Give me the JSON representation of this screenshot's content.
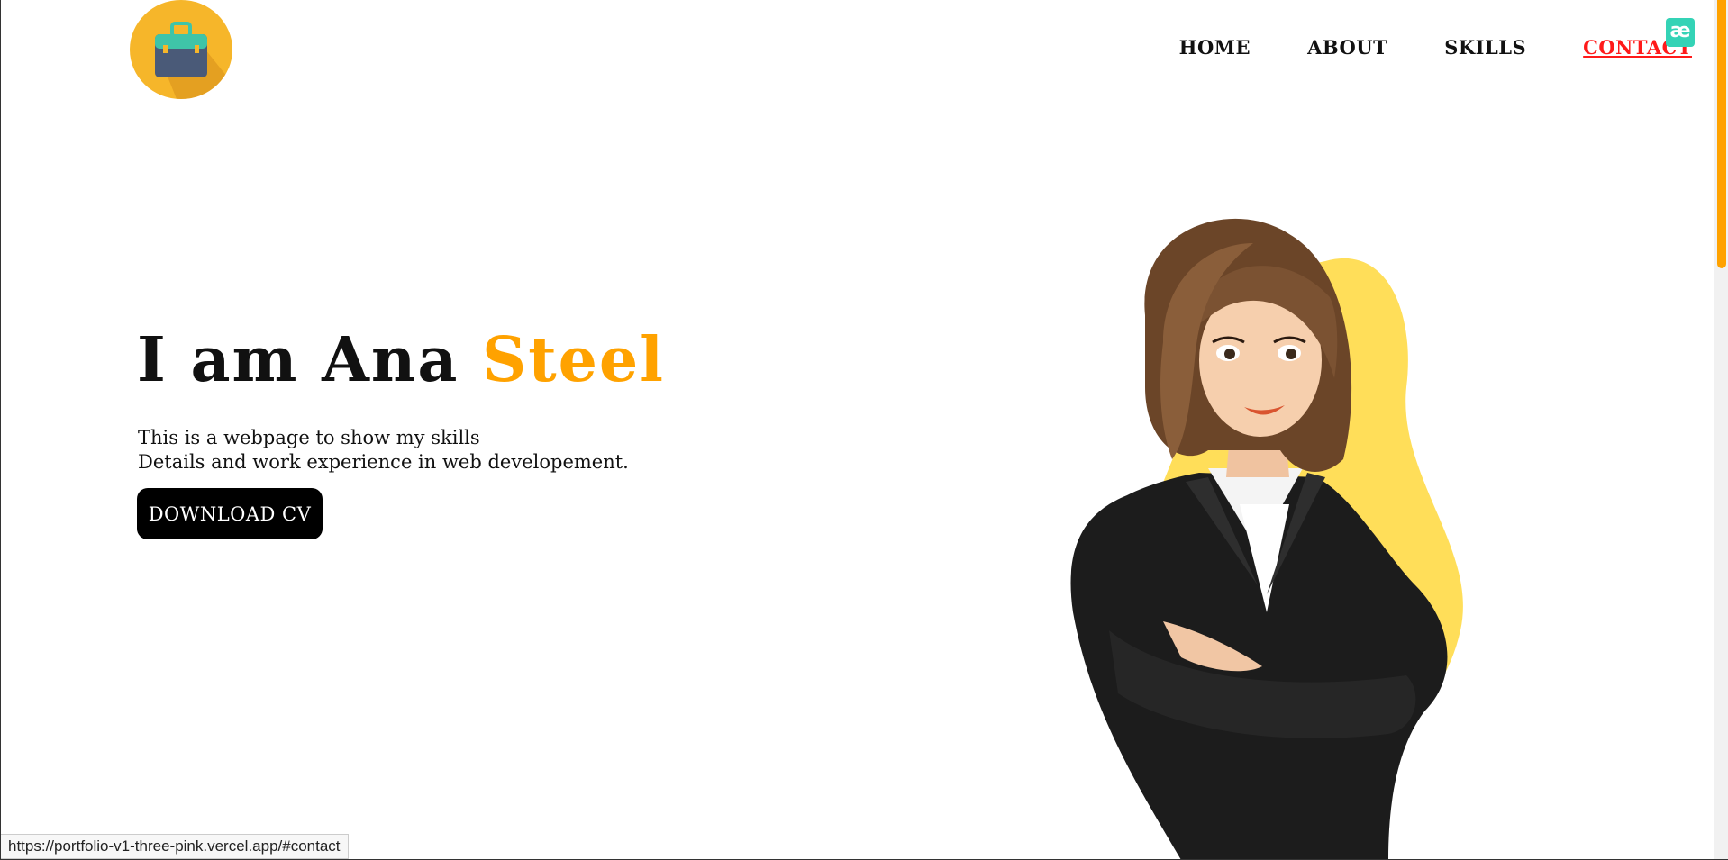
{
  "logo": {
    "icon": "briefcase-icon",
    "bg_color": "#f6b62a"
  },
  "nav": {
    "items": [
      {
        "label": "HOME"
      },
      {
        "label": "ABOUT"
      },
      {
        "label": "SKILLS"
      },
      {
        "label": "CONTACT",
        "active": true
      }
    ]
  },
  "extension_badge": {
    "label": "æ",
    "icon": "extension-icon"
  },
  "hero": {
    "title_prefix": "I am Ana ",
    "title_accent": "Steel",
    "accent_color": "#ffa200",
    "desc_line1": "This is a webpage to show my skills",
    "desc_line2": "Details and work experience in web developement.",
    "cv_button": "DOWNLOAD CV"
  },
  "status_bar": {
    "url": "https://portfolio-v1-three-pink.vercel.app/#contact"
  },
  "colors": {
    "accent": "#ffa200",
    "nav_active": "#ff1a1a",
    "blob": "#ffde59"
  }
}
